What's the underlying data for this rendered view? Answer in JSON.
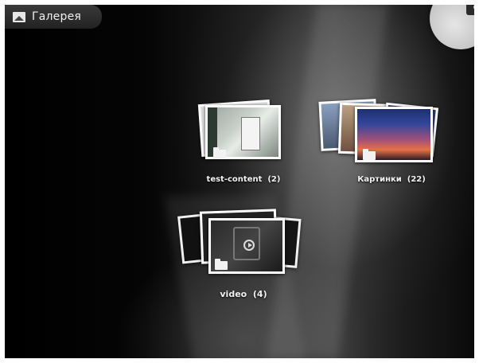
{
  "app": {
    "title": "Галерея",
    "title_icon": "gallery-icon",
    "camera_icon": "camera-icon"
  },
  "albums": [
    {
      "name": "test-content",
      "count": "(2)"
    },
    {
      "name": "Картинки",
      "count": "(22)"
    },
    {
      "name": "video",
      "count": "(4)"
    }
  ],
  "colors": {
    "background": "#000000",
    "label_text": "#f2f2f2",
    "card_border": "#ffffff",
    "camera_button": "#c8c8c8"
  }
}
